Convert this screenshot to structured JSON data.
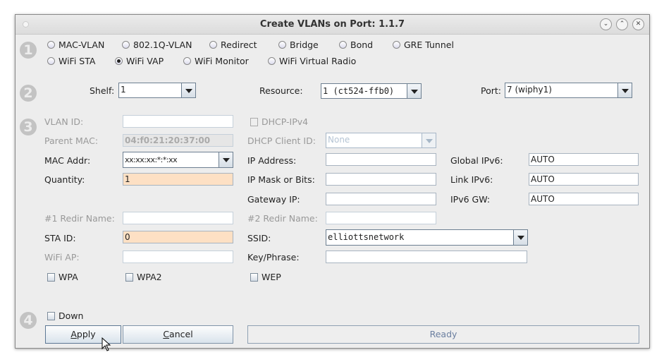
{
  "window": {
    "title": "Create VLANs on Port: 1.1.7"
  },
  "steps": [
    "1",
    "2",
    "3",
    "4"
  ],
  "types": [
    {
      "label": "MAC-VLAN",
      "selected": false
    },
    {
      "label": "802.1Q-VLAN",
      "selected": false
    },
    {
      "label": "Redirect",
      "selected": false
    },
    {
      "label": "Bridge",
      "selected": false
    },
    {
      "label": "Bond",
      "selected": false
    },
    {
      "label": "GRE Tunnel",
      "selected": false
    },
    {
      "label": "WiFi STA",
      "selected": false
    },
    {
      "label": "WiFi VAP",
      "selected": true
    },
    {
      "label": "WiFi Monitor",
      "selected": false
    },
    {
      "label": "WiFi Virtual Radio",
      "selected": false
    }
  ],
  "location": {
    "shelf_label": "Shelf:",
    "shelf": "1",
    "resource_label": "Resource:",
    "resource": "1 (ct524-ffb0)",
    "port_label": "Port:",
    "port": "7 (wiphy1)"
  },
  "form": {
    "vlan_id_label": "VLAN ID:",
    "vlan_id": "",
    "parent_mac_label": "Parent MAC:",
    "parent_mac": "04:f0:21:20:37:00",
    "mac_addr_label": "MAC Addr:",
    "mac_addr": "xx:xx:xx:*:*:xx",
    "quantity_label": "Quantity:",
    "quantity": "1",
    "redir1_label": "#1 Redir Name:",
    "redir1": "",
    "sta_id_label": "STA ID:",
    "sta_id": "0",
    "wifi_ap_label": "WiFi AP:",
    "wifi_ap": "",
    "wpa": "WPA",
    "wpa2": "WPA2",
    "wep": "WEP",
    "dhcp_ipv4": "DHCP-IPv4",
    "dhcp_client_label": "DHCP Client ID:",
    "dhcp_client": "None",
    "ip_label": "IP Address:",
    "ip": "",
    "mask_label": "IP Mask or Bits:",
    "mask": "",
    "gw_label": "Gateway IP:",
    "gw": "",
    "redir2_label": "#2 Redir Name:",
    "redir2": "",
    "ssid_label": "SSID:",
    "ssid": "elliottsnetwork",
    "key_label": "Key/Phrase:",
    "key": "",
    "gipv6_label": "Global IPv6:",
    "gipv6": "AUTO",
    "lipv6_label": "Link IPv6:",
    "lipv6": "AUTO",
    "ipv6gw_label": "IPv6 GW:",
    "ipv6gw": "AUTO"
  },
  "bottom": {
    "down": "Down",
    "apply": "Apply",
    "cancel": "Cancel",
    "status": "Ready"
  }
}
